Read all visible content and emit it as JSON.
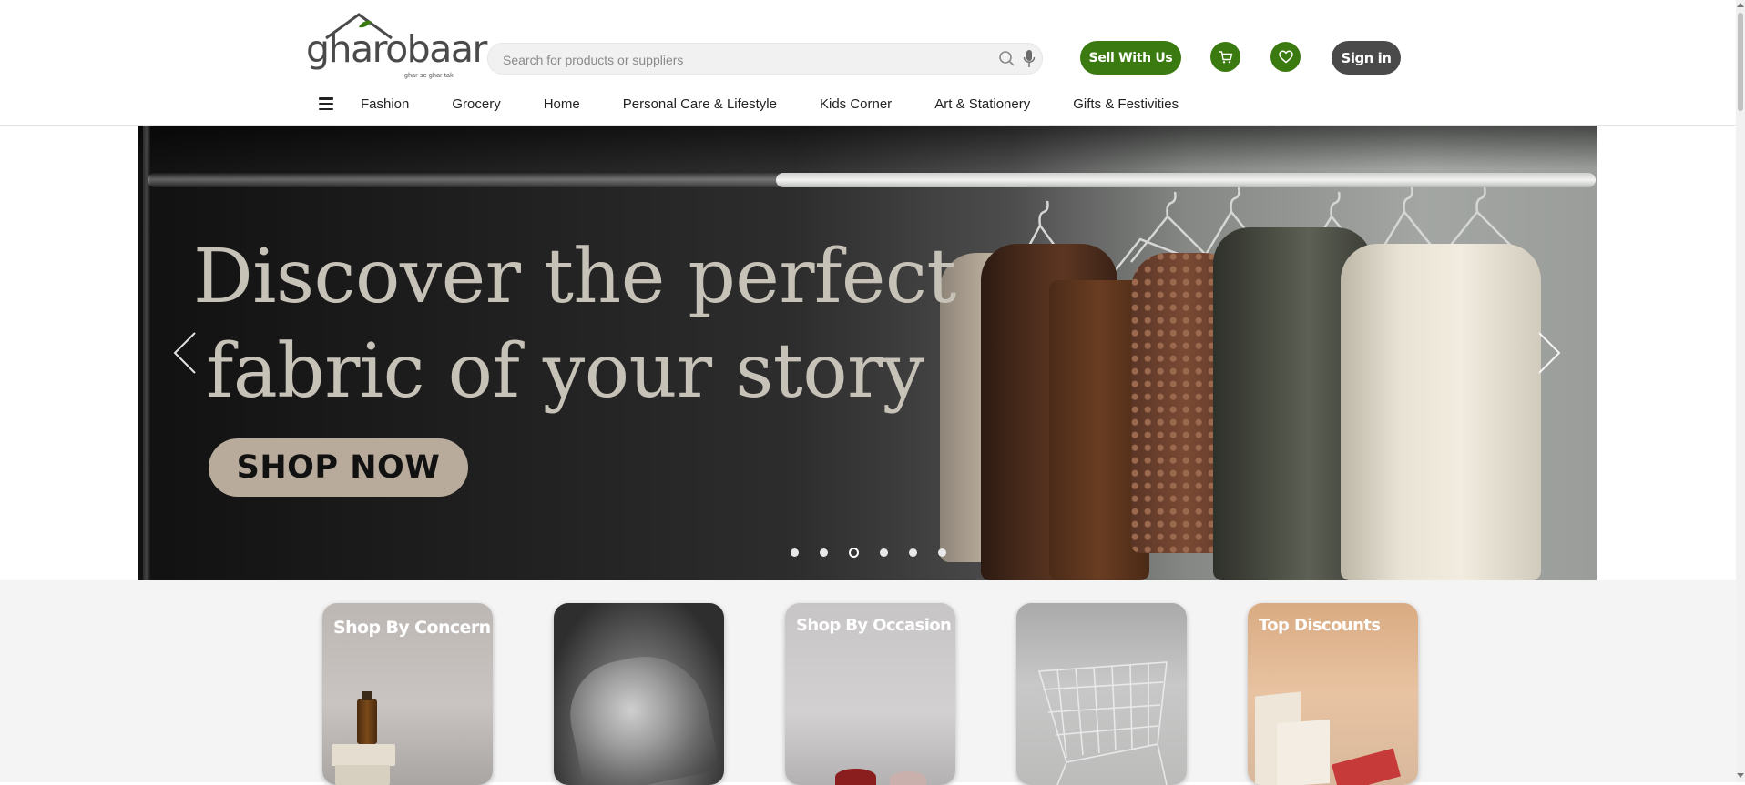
{
  "brand": {
    "name": "gharobaar",
    "tagline": "ghar se ghar tak"
  },
  "search": {
    "placeholder": "Search for products or suppliers",
    "value": ""
  },
  "header": {
    "sell_label": "Sell With Us",
    "signin_label": "Sign in",
    "cart_icon": "cart-icon",
    "wishlist_icon": "heart-icon"
  },
  "nav": {
    "menu_icon": "hamburger-icon",
    "items": [
      {
        "label": "Fashion"
      },
      {
        "label": "Grocery"
      },
      {
        "label": "Home"
      },
      {
        "label": "Personal Care & Lifestyle"
      },
      {
        "label": "Kids Corner"
      },
      {
        "label": "Art & Stationery"
      },
      {
        "label": "Gifts & Festivities"
      }
    ]
  },
  "hero": {
    "headline_line1": "Discover the perfect",
    "headline_line2": "fabric of your story",
    "cta_label": "SHOP NOW",
    "slide_count": 6,
    "active_slide": 3
  },
  "categories": [
    {
      "label": "Shop By Concern"
    },
    {
      "label": ""
    },
    {
      "label": "Shop By Occasion"
    },
    {
      "label": ""
    },
    {
      "label": "Top Discounts"
    }
  ],
  "colors": {
    "brand_green": "#3a7a10",
    "dark_button": "#4a4a4a",
    "cta_beige": "#b8ab9b",
    "headline": "#c7c2b8"
  }
}
